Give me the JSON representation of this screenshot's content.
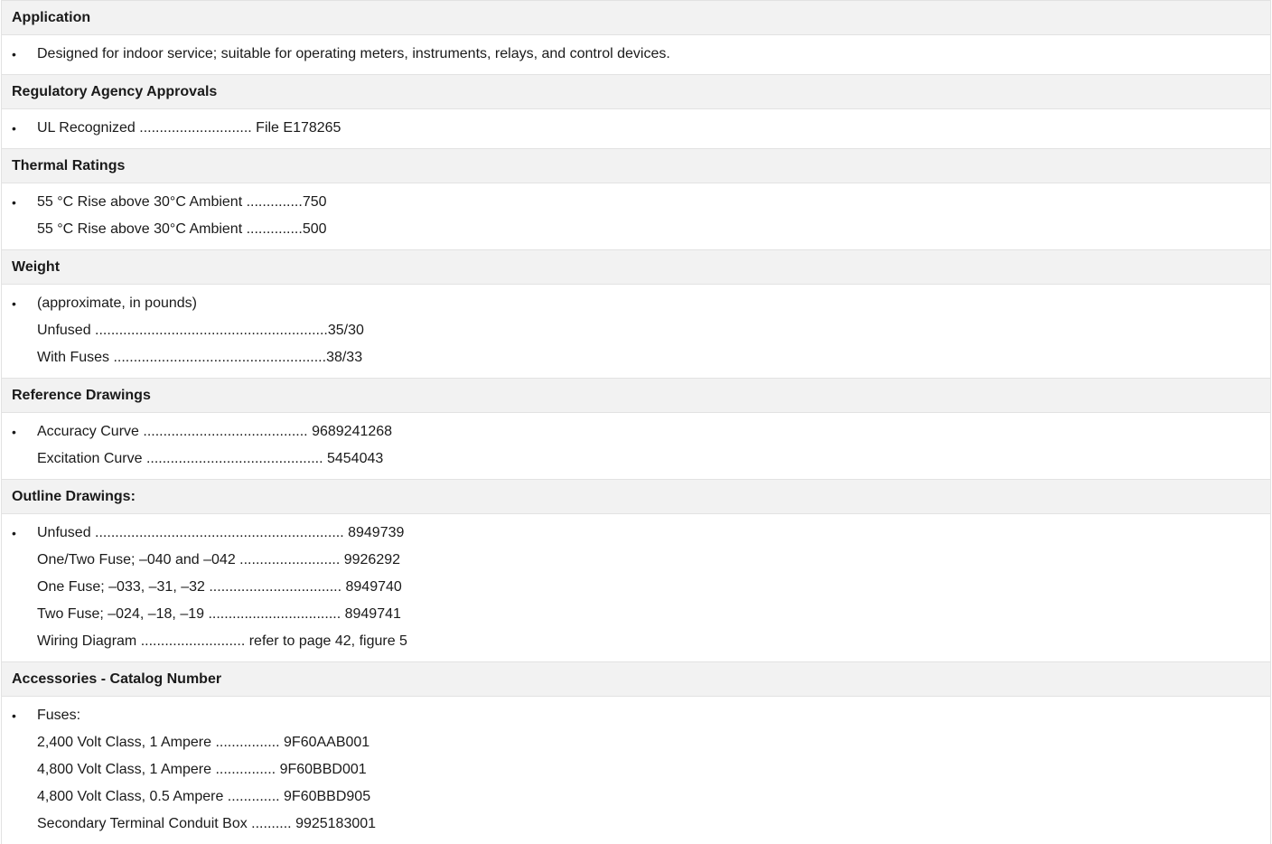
{
  "sections": [
    {
      "title": "Application",
      "lines": [
        "Designed for indoor service; suitable for operating meters, instruments, relays, and control devices."
      ]
    },
    {
      "title": "Regulatory Agency Approvals",
      "lines": [
        "UL Recognized ............................ File E178265"
      ]
    },
    {
      "title": "Thermal Ratings",
      "lines": [
        "55 °C Rise above 30°C Ambient ..............750",
        "55 °C Rise above 30°C Ambient ..............500"
      ]
    },
    {
      "title": "Weight",
      "lines": [
        "(approximate, in pounds)",
        "Unfused ..........................................................35/30",
        "With Fuses .....................................................38/33"
      ]
    },
    {
      "title": "Reference Drawings",
      "lines": [
        "Accuracy Curve ......................................... 9689241268",
        "Excitation Curve ............................................ 5454043"
      ]
    },
    {
      "title": "Outline Drawings:",
      "lines": [
        "Unfused .............................................................. 8949739",
        "One/Two Fuse; –040 and –042 ......................... 9926292",
        "One Fuse; –033, –31, –32 ................................. 8949740",
        "Two Fuse; –024, –18, –19 ................................. 8949741",
        "Wiring Diagram .......................... refer to page 42, figure 5"
      ]
    },
    {
      "title": "Accessories - Catalog Number",
      "lines": [
        "Fuses:",
        "2,400 Volt Class, 1 Ampere ................ 9F60AAB001",
        "4,800 Volt Class, 1 Ampere ............... 9F60BBD001",
        "4,800 Volt Class, 0.5 Ampere ............. 9F60BBD905",
        "Secondary Terminal Conduit Box .......... 9925183001"
      ]
    }
  ],
  "bullet_glyph": "•"
}
